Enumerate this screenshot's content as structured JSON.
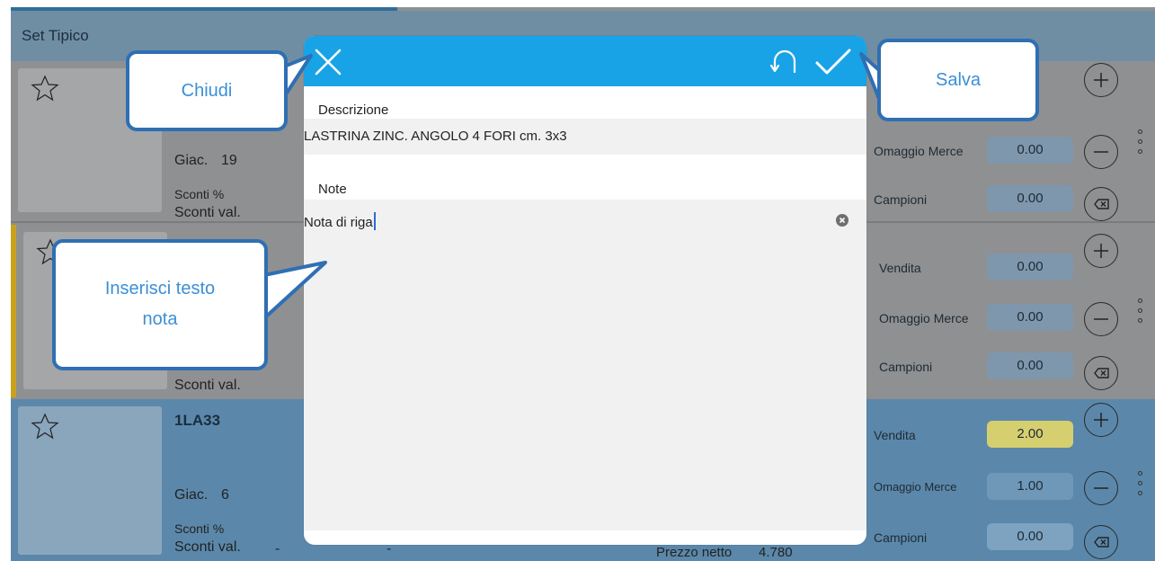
{
  "app": {
    "set_title": "Set Tipico",
    "rows": [
      {
        "code": "",
        "giac_label": "Giac.",
        "giac_value": "19",
        "sconti_pct_label": "Sconti %",
        "sconti_val_label": "Sconti val.",
        "omaggio_label": "Omaggio Merce",
        "omaggio_value": "0.00",
        "campioni_label": "Campioni",
        "campioni_value": "0.00"
      },
      {
        "sconti_val_label": "Sconti val.",
        "vendita_label": "Vendita",
        "vendita_value": "0.00",
        "omaggio_label": "Omaggio Merce",
        "omaggio_value": "0.00",
        "campioni_label": "Campioni",
        "campioni_value": "0.00"
      },
      {
        "code": "1LA33",
        "giac_label": "Giac.",
        "giac_value": "6",
        "sconti_pct_label": "Sconti %",
        "sconti_val_label": "Sconti val.",
        "dash": "-",
        "prezzo_label": "Prezzo netto",
        "prezzo_value": "4.780",
        "vendita_label": "Vendita",
        "vendita_value": "2.00",
        "omaggio_label": "Omaggio Merce",
        "omaggio_value": "1.00",
        "campioni_label": "Campioni",
        "campioni_value": "0.00"
      }
    ]
  },
  "modal": {
    "header_color": "#18a3e6",
    "close_icon": "close-icon",
    "undo_icon": "undo-icon",
    "save_icon": "checkmark-icon",
    "description_label": "Descrizione",
    "description_value": "LASTRINA ZINC. ANGOLO 4 FORI cm. 3x3",
    "note_label": "Note",
    "note_value": "Nota di riga"
  },
  "callouts": {
    "close": "Chiudi",
    "save": "Salva",
    "note_line1": "Inserisci testo",
    "note_line2": "nota"
  },
  "colors": {
    "callout_border": "#2f6fb3",
    "callout_text": "#3b8fd6",
    "highlight_qty": "#d6cf6f",
    "selected_row": "#5b88aa",
    "row_accent": "#c9a11c"
  }
}
